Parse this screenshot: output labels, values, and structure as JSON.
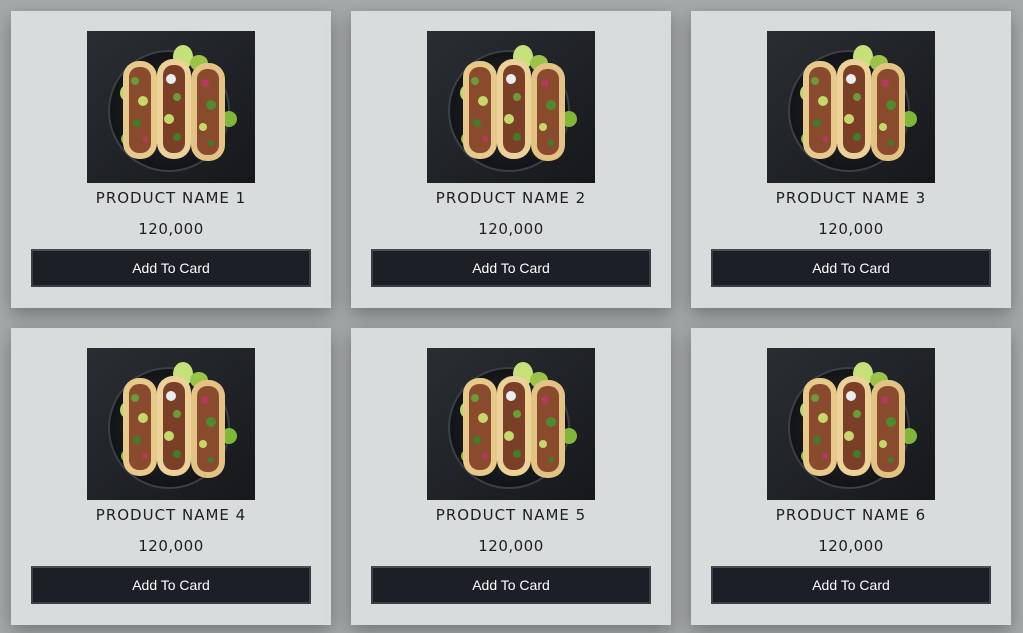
{
  "products": [
    {
      "name": "PRODUCT NAME 1",
      "price": "120,000",
      "button_label": "Add To Card"
    },
    {
      "name": "PRODUCT NAME 2",
      "price": "120,000",
      "button_label": "Add To Card"
    },
    {
      "name": "PRODUCT NAME 3",
      "price": "120,000",
      "button_label": "Add To Card"
    },
    {
      "name": "PRODUCT NAME 4",
      "price": "120,000",
      "button_label": "Add To Card"
    },
    {
      "name": "PRODUCT NAME 5",
      "price": "120,000",
      "button_label": "Add To Card"
    },
    {
      "name": "PRODUCT NAME 6",
      "price": "120,000",
      "button_label": "Add To Card"
    }
  ],
  "colors": {
    "page_background": "#a7aaab",
    "card_background": "#d9dcdd",
    "button_background": "#1c1f26",
    "button_text": "#ffffff"
  },
  "icons": {
    "product_image": "tacos-photo"
  }
}
